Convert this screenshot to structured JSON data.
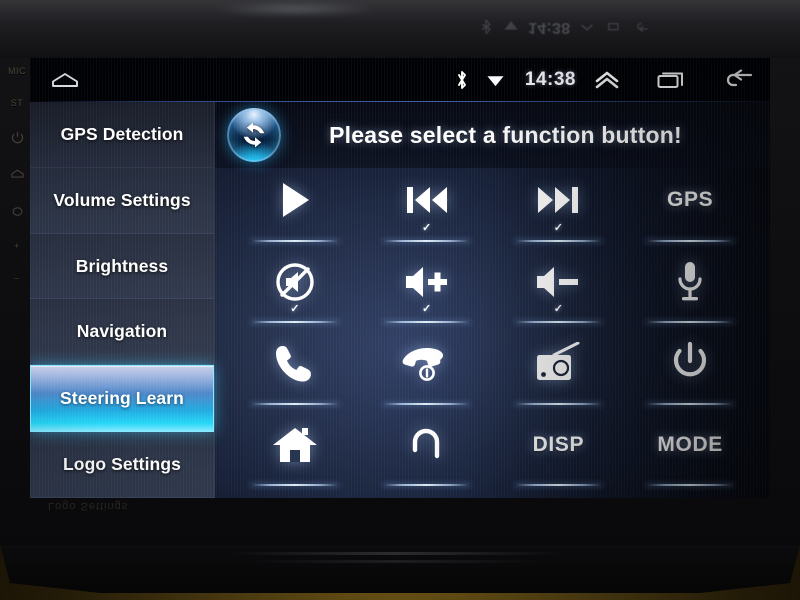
{
  "device": {
    "hardware_buttons": [
      {
        "name": "mic-label",
        "label": "MIC",
        "icon": "text"
      },
      {
        "name": "st-label",
        "label": "ST",
        "icon": "text"
      },
      {
        "name": "power-key",
        "label": "",
        "icon": "power-icon"
      },
      {
        "name": "home-key",
        "label": "",
        "icon": "home-icon"
      },
      {
        "name": "back-key",
        "label": "",
        "icon": "back-icon"
      },
      {
        "name": "vol-up-key",
        "label": "+",
        "icon": "text"
      },
      {
        "name": "vol-down-key",
        "label": "–",
        "icon": "text"
      }
    ],
    "bezel_reflection_text": "14:38"
  },
  "statusbar": {
    "home_icon": "home-icon",
    "bluetooth_icon": "bluetooth-icon",
    "wifi_icon": "wifi-icon",
    "time": "14:38",
    "expand_icon": "chevron-up-icon",
    "recents_icon": "recent-apps-icon",
    "back_icon": "back-arrow-icon"
  },
  "sidebar": {
    "items": [
      {
        "label": "GPS Detection",
        "active": false
      },
      {
        "label": "Volume Settings",
        "active": false
      },
      {
        "label": "Brightness",
        "active": false
      },
      {
        "label": "Navigation",
        "active": false
      },
      {
        "label": "Steering Learn",
        "active": true
      },
      {
        "label": "Logo Settings",
        "active": false
      }
    ]
  },
  "header": {
    "sync_icon": "sync-refresh-icon",
    "title": "Please select a function button!"
  },
  "grid": {
    "buttons": [
      {
        "name": "play",
        "icon": "play-icon",
        "text": "",
        "checked": false
      },
      {
        "name": "previous",
        "icon": "previous-icon",
        "text": "",
        "checked": true
      },
      {
        "name": "next",
        "icon": "next-icon",
        "text": "",
        "checked": true
      },
      {
        "name": "gps",
        "icon": "text",
        "text": "GPS",
        "checked": false
      },
      {
        "name": "mute",
        "icon": "mute-icon",
        "text": "",
        "checked": true
      },
      {
        "name": "volume-up",
        "icon": "volume-up-icon",
        "text": "",
        "checked": true
      },
      {
        "name": "volume-down",
        "icon": "volume-down-icon",
        "text": "",
        "checked": true
      },
      {
        "name": "voice",
        "icon": "microphone-icon",
        "text": "",
        "checked": false
      },
      {
        "name": "call-answer",
        "icon": "phone-answer-icon",
        "text": "",
        "checked": false
      },
      {
        "name": "call-end",
        "icon": "phone-hangup-icon",
        "text": "",
        "checked": false
      },
      {
        "name": "radio",
        "icon": "radio-icon",
        "text": "",
        "checked": false
      },
      {
        "name": "power",
        "icon": "power-icon",
        "text": "",
        "checked": false
      },
      {
        "name": "home",
        "icon": "home-solid-icon",
        "text": "",
        "checked": false
      },
      {
        "name": "return",
        "icon": "return-arrow-icon",
        "text": "",
        "checked": false
      },
      {
        "name": "disp",
        "icon": "text",
        "text": "DISP",
        "checked": false
      },
      {
        "name": "mode",
        "icon": "text",
        "text": "MODE",
        "checked": false
      }
    ],
    "check_glyph": "✓"
  },
  "colors": {
    "accent_cyan": "#23d6f7",
    "screen_bg": "#1d2945",
    "sidebar_bg": "#242b3c",
    "statusbar_bg": "#000105",
    "text": "#ffffff"
  }
}
